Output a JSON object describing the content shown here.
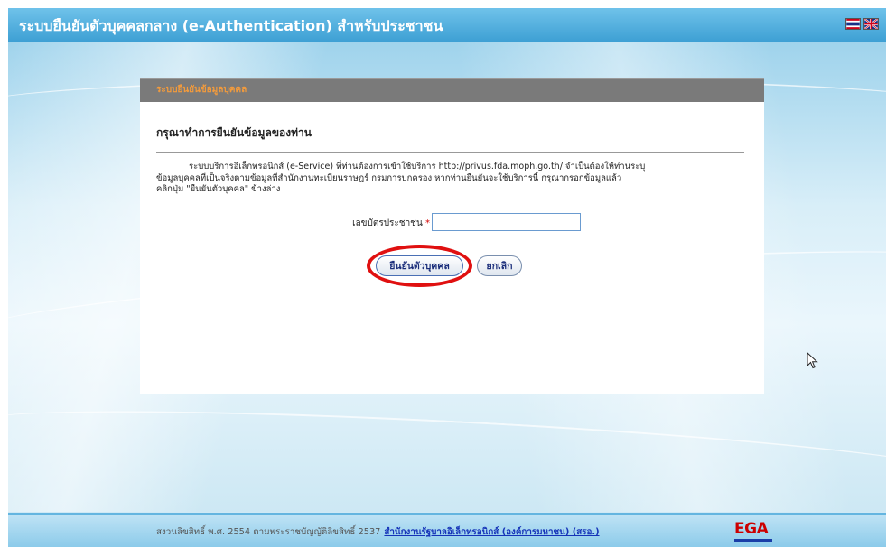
{
  "header": {
    "title": "ระบบยืนยันตัวบุคคลกลาง (e-Authentication) สำหรับประชาชน",
    "flags": [
      "thai-flag-icon",
      "uk-flag-icon"
    ]
  },
  "panel": {
    "head_label": "ระบบยืนยันข้อมูลบุคคล",
    "title": "กรุณาทำการยืนยันข้อมูลของท่าน",
    "description_lines": [
      "ระบบบริการอิเล็กทรอนิกส์ (e-Service) ที่ท่านต้องการเข้าใช้บริการ http://privus.fda.moph.go.th/ จำเป็นต้องให้ท่านระบุ",
      "ข้อมูลบุคคลที่เป็นจริงตามข้อมูลที่สำนักงานทะเบียนราษฎร์ กรมการปกครอง หากท่านยืนยันจะใช้บริการนี้ กรุณากรอกข้อมูลแล้ว",
      "คลิกปุ่ม \"ยืนยันตัวบุคคล\" ข้างล่าง"
    ],
    "id_label": "เลขบัตรประชาชน",
    "required_mark": "*",
    "id_value": "",
    "verify_button": "ยืนยันตัวบุคคล",
    "cancel_button": "ยกเลิก"
  },
  "footer": {
    "copyright": "สงวนลิขสิทธิ์ พ.ศ. 2554 ตามพระราชบัญญัติลิขสิทธิ์ 2537",
    "link": "สำนักงานรัฐบาลอิเล็กทรอนิกส์ (องค์การมหาชน) (สรอ.)",
    "logo": "EGA"
  },
  "colors": {
    "header_bg": "#3ea0d4",
    "panel_head_bg": "#7a7a7a",
    "panel_head_text": "#f39b3c",
    "highlight_circle": "#e01010",
    "link": "#1533b8"
  }
}
